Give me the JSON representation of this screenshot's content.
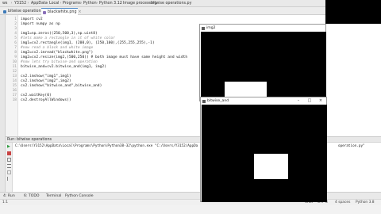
{
  "breadcrumbs": [
    "ws",
    "Y3152",
    "AppData",
    "Local",
    "Programs",
    "Python",
    "Python 3.12",
    "Image processing",
    "bitwise operations.py"
  ],
  "file_tabs": [
    {
      "label": "bitwise operations.py",
      "active": false
    },
    {
      "label": "blackwhite.png",
      "active": true
    }
  ],
  "top_right_tab": "bitwise operation",
  "editor": {
    "line_numbers": [
      "1",
      "2",
      "3",
      "4",
      "5",
      "6",
      "7",
      "8",
      "9",
      "10",
      "11",
      "12",
      "13",
      "14",
      "15",
      "16",
      "17",
      "18",
      "19",
      "20",
      "21",
      "22"
    ],
    "lines": [
      {
        "text": "import cv2",
        "kind": "code"
      },
      {
        "text": "import numpy as np",
        "kind": "code"
      },
      {
        "text": "",
        "kind": "code"
      },
      {
        "text": "img1=np.zeros((250,500,3),np.uint8)",
        "kind": "code"
      },
      {
        "text": "#lets make a rectangle in it of white color",
        "kind": "comment"
      },
      {
        "text": "img1=cv2.rectangle(img1, (200,0), (250,100),(255,255,255),-1)",
        "kind": "code"
      },
      {
        "text": "#now read a black and white image",
        "kind": "comment"
      },
      {
        "text": "img2=cv2.imread(\"blackwhite.png\")",
        "kind": "code"
      },
      {
        "text": "img2=cv2.resize(img2,(500,250)) # both image must have same height and width",
        "kind": "code"
      },
      {
        "text": "#now lets try bitwise-and operation",
        "kind": "comment"
      },
      {
        "text": "bitwise_and=cv2.bitwise_and(img1, img2)",
        "kind": "code"
      },
      {
        "text": "",
        "kind": "code"
      },
      {
        "text": "cv2.imshow(\"img1\",img1)",
        "kind": "code"
      },
      {
        "text": "cv2.imshow(\"img2\",img2)",
        "kind": "code"
      },
      {
        "text": "cv2.imshow(\"bitwise_and\",bitwise_and)",
        "kind": "code"
      },
      {
        "text": "",
        "kind": "code"
      },
      {
        "text": "cv2.waitKey(0)",
        "kind": "code"
      },
      {
        "text": "cv2.destroyAllWindows()",
        "kind": "code"
      }
    ]
  },
  "run_panel": {
    "label_run": "Run:",
    "label_config": "bitwise operations",
    "command": "C:\\Users\\Y3152\\AppData\\Local\\Programs\\Python\\Python38-32\\python.exe \"C:/Users/Y3152/AppDa",
    "command_tail": "operation.py\""
  },
  "tool_tabs": [
    "4: Run",
    "6: TODO",
    "Terminal",
    "Python Console"
  ],
  "status_bar": {
    "left": "1:1",
    "items": [
      "CRLF",
      "UTF-8",
      "4 spaces",
      "Python 3.8"
    ]
  },
  "cv_windows": [
    {
      "title": "img2",
      "id": "img2"
    },
    {
      "title": "bitwise_and",
      "id": "bitwise_and"
    }
  ]
}
